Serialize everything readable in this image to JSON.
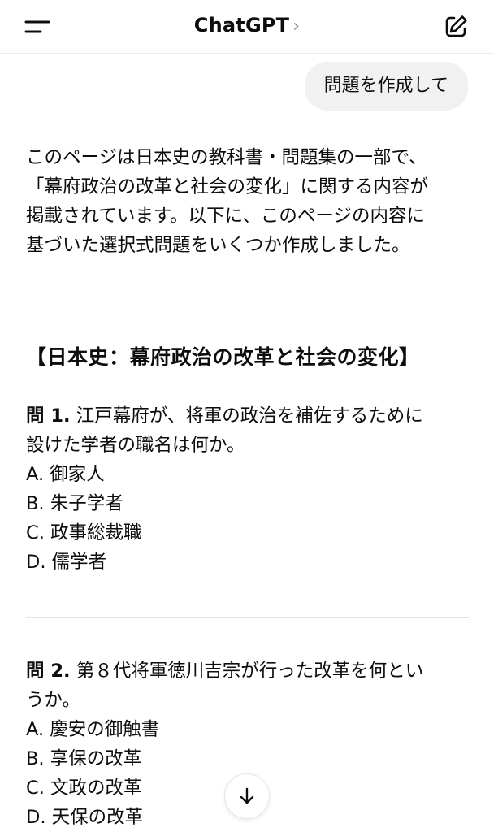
{
  "header": {
    "title": "ChatGPT",
    "title_chevron": "›"
  },
  "user_message": "問題を作成して",
  "assistant": {
    "intro_lines": [
      "このページは日本史の教科書・問題集の一部で、",
      "「幕府政治の改革と社会の変化」に関する内容が",
      "掲載されています。以下に、このページの内容に",
      "基づいた選択式問題をいくつか作成しました。"
    ],
    "section_title": "【日本史：幕府政治の改革と社会の変化】",
    "questions": [
      {
        "label": "問 1.",
        "text_lines": [
          "江戸幕府が、将軍の政治を補佐するために",
          "設けた学者の職名は何か。"
        ],
        "options": [
          "A. 御家人",
          "B. 朱子学者",
          "C. 政事総裁職",
          "D. 儒学者"
        ]
      },
      {
        "label": "問 2.",
        "text_lines": [
          "第８代将軍徳川吉宗が行った改革を何とい",
          "うか。"
        ],
        "options": [
          "A. 慶安の御触書",
          "B. 享保の改革",
          "C. 文政の改革",
          "D. 天保の改革"
        ]
      }
    ]
  },
  "icons": {
    "menu": "menu-icon",
    "edit": "new-chat-icon",
    "scroll_down": "arrow-down-icon"
  }
}
